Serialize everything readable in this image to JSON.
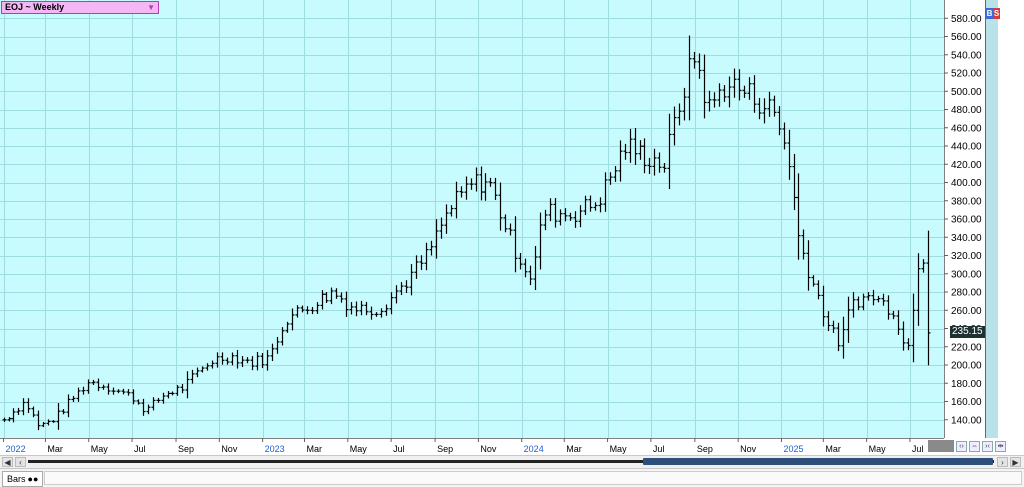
{
  "symbol_label": "EOJ ~ Weekly",
  "last_price_label": "235.15",
  "status": {
    "bars_tab_label": "Bars"
  },
  "colors": {
    "background": "#c8fbfe",
    "grid": "#9fdde2",
    "bars": "#000000",
    "year_labels": "#1f5fd1",
    "symbol_box": "#f4b6f4"
  },
  "chart_data": {
    "type": "ohlc",
    "timeframe": "Weekly",
    "ylim": [
      120,
      600
    ],
    "xlim": [
      "2021-12-27",
      "2025-08-18"
    ],
    "y_ticks": [
      140,
      160,
      180,
      200,
      220,
      240,
      260,
      280,
      300,
      320,
      340,
      360,
      380,
      400,
      420,
      440,
      460,
      480,
      500,
      520,
      540,
      560,
      580
    ],
    "y_tick_labels": [
      "140.00",
      "160.00",
      "180.00",
      "200.00",
      "220.00",
      "240.00",
      "260.00",
      "280.00",
      "300.00",
      "320.00",
      "340.00",
      "360.00",
      "380.00",
      "400.00",
      "420.00",
      "440.00",
      "460.00",
      "480.00",
      "500.00",
      "520.00",
      "540.00",
      "560.00",
      "580.00"
    ],
    "x_ticks": [
      {
        "label": "2022",
        "date": "2022-01-01",
        "year": true
      },
      {
        "label": "Mar",
        "date": "2022-03-01",
        "year": false
      },
      {
        "label": "May",
        "date": "2022-05-01",
        "year": false
      },
      {
        "label": "Jul",
        "date": "2022-07-01",
        "year": false
      },
      {
        "label": "Sep",
        "date": "2022-09-01",
        "year": false
      },
      {
        "label": "Nov",
        "date": "2022-11-01",
        "year": false
      },
      {
        "label": "2023",
        "date": "2023-01-01",
        "year": true
      },
      {
        "label": "Mar",
        "date": "2023-03-01",
        "year": false
      },
      {
        "label": "May",
        "date": "2023-05-01",
        "year": false
      },
      {
        "label": "Jul",
        "date": "2023-07-01",
        "year": false
      },
      {
        "label": "Sep",
        "date": "2023-09-01",
        "year": false
      },
      {
        "label": "Nov",
        "date": "2023-11-01",
        "year": false
      },
      {
        "label": "2024",
        "date": "2024-01-01",
        "year": true
      },
      {
        "label": "Mar",
        "date": "2024-03-01",
        "year": false
      },
      {
        "label": "May",
        "date": "2024-05-01",
        "year": false
      },
      {
        "label": "Jul",
        "date": "2024-07-01",
        "year": false
      },
      {
        "label": "Sep",
        "date": "2024-09-01",
        "year": false
      },
      {
        "label": "Nov",
        "date": "2024-11-01",
        "year": false
      },
      {
        "label": "2025",
        "date": "2025-01-01",
        "year": true
      },
      {
        "label": "Mar",
        "date": "2025-03-01",
        "year": false
      },
      {
        "label": "May",
        "date": "2025-05-01",
        "year": false
      },
      {
        "label": "Jul",
        "date": "2025-07-01",
        "year": false
      }
    ],
    "last_price": 235.15,
    "grid": true,
    "series": [
      {
        "anchors": [
          [
            "2022-01-01",
            140
          ],
          [
            "2022-02-01",
            160
          ],
          [
            "2022-02-20",
            132
          ],
          [
            "2022-03-15",
            142
          ],
          [
            "2022-04-10",
            165
          ],
          [
            "2022-05-01",
            182
          ],
          [
            "2022-06-01",
            175
          ],
          [
            "2022-07-01",
            165
          ],
          [
            "2022-07-20",
            150
          ],
          [
            "2022-08-15",
            168
          ],
          [
            "2022-09-10",
            175
          ],
          [
            "2022-10-20",
            205
          ],
          [
            "2022-11-15",
            210
          ],
          [
            "2022-12-15",
            203
          ],
          [
            "2023-01-10",
            208
          ],
          [
            "2023-02-01",
            250
          ],
          [
            "2023-03-01",
            262
          ],
          [
            "2023-04-10",
            280
          ],
          [
            "2023-05-10",
            262
          ],
          [
            "2023-06-15",
            262
          ],
          [
            "2023-07-20",
            290
          ],
          [
            "2023-08-20",
            320
          ],
          [
            "2023-09-20",
            370
          ],
          [
            "2023-10-20",
            398
          ],
          [
            "2023-11-15",
            402
          ],
          [
            "2023-12-01",
            370
          ],
          [
            "2023-12-20",
            330
          ],
          [
            "2024-01-15",
            295
          ],
          [
            "2024-02-01",
            368
          ],
          [
            "2024-03-10",
            365
          ],
          [
            "2024-04-15",
            378
          ],
          [
            "2024-05-01",
            400
          ],
          [
            "2024-05-25",
            440
          ],
          [
            "2024-06-20",
            430
          ],
          [
            "2024-07-20",
            420
          ],
          [
            "2024-08-15",
            500
          ],
          [
            "2024-09-01",
            540
          ],
          [
            "2024-09-20",
            480
          ],
          [
            "2024-10-15",
            510
          ],
          [
            "2024-11-20",
            495
          ],
          [
            "2024-12-20",
            478
          ],
          [
            "2025-01-10",
            430
          ],
          [
            "2025-01-25",
            340
          ],
          [
            "2025-02-10",
            300
          ],
          [
            "2025-03-10",
            240
          ],
          [
            "2025-03-25",
            222
          ],
          [
            "2025-04-10",
            270
          ],
          [
            "2025-05-10",
            275
          ],
          [
            "2025-06-10",
            258
          ],
          [
            "2025-06-25",
            212
          ],
          [
            "2025-07-01",
            230
          ],
          [
            "2025-07-10",
            312
          ],
          [
            "2025-07-24",
            322
          ],
          [
            "2025-07-31",
            235.15
          ]
        ]
      }
    ]
  }
}
